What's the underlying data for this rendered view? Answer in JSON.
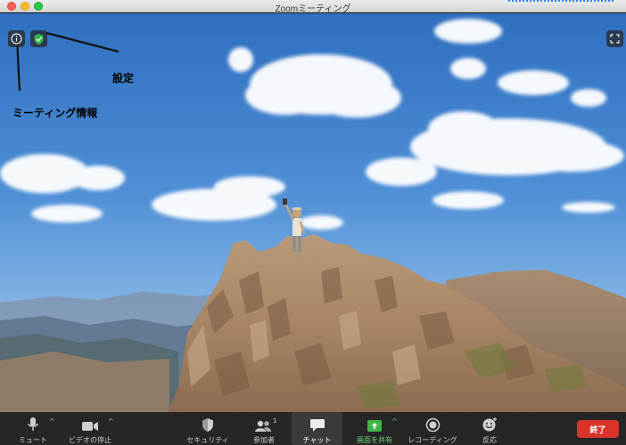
{
  "window": {
    "title": "Zoomミーティング"
  },
  "annotations": {
    "settings": "設定",
    "meeting_info": "ミーティング情報"
  },
  "toolbar": {
    "mute": "ミュート",
    "stop_video": "ビデオの停止",
    "security": "セキュリティ",
    "participants": "参加者",
    "participants_count": "1",
    "chat": "チャット",
    "share_screen": "画面を共有",
    "recording": "レコーディング",
    "reactions": "反応",
    "end": "終了"
  },
  "colors": {
    "end_button": "#d9342b",
    "share_green": "#3fb549",
    "shield_green": "#32b34a",
    "toolbar_bg": "#262626"
  }
}
